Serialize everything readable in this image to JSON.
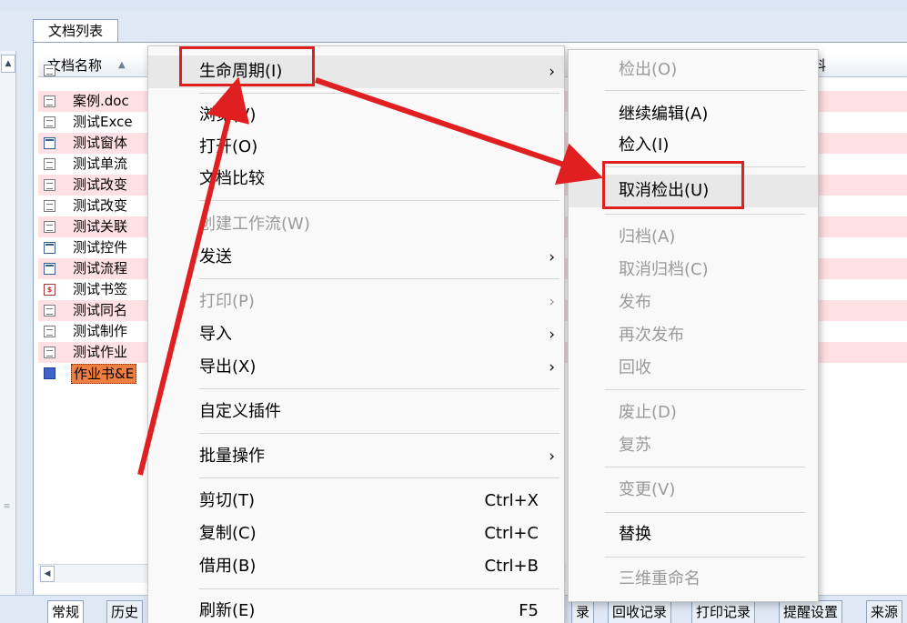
{
  "window": {
    "tab_label": "文档列表",
    "column_name": "文档名称",
    "sort_arrow": "▲",
    "column_right": "料"
  },
  "rows": [
    {
      "name": "案例.doc",
      "icon": "doc-icon"
    },
    {
      "name": "测试Exce",
      "icon": "doc-icon"
    },
    {
      "name": "测试窗体",
      "icon": "form-icon"
    },
    {
      "name": "测试单流",
      "icon": "doc-icon"
    },
    {
      "name": "测试改变",
      "icon": "doc-icon"
    },
    {
      "name": "测试改变",
      "icon": "doc-icon"
    },
    {
      "name": "测试关联",
      "icon": "doc-icon"
    },
    {
      "name": "测试控件",
      "icon": "form-icon"
    },
    {
      "name": "测试流程",
      "icon": "form-icon"
    },
    {
      "name": "测试书签",
      "icon": "bookmark-icon",
      "icon_text": "$"
    },
    {
      "name": "测试同名",
      "icon": "doc-icon"
    },
    {
      "name": "测试制作",
      "icon": "doc-icon"
    },
    {
      "name": "测试作业",
      "icon": "doc-icon"
    },
    {
      "name": "作业书&E",
      "icon": "blue-doc-icon"
    }
  ],
  "bottom_tabs": {
    "left": [
      "常规",
      "历史"
    ],
    "right": [
      "录",
      "回收记录",
      "打印记录",
      "提醒设置",
      "来源"
    ]
  },
  "context_menu": {
    "lifecycle": "生命周期(I)",
    "browse": "浏览(V)",
    "open": "打开(O)",
    "compare": "文档比较",
    "create_workflow": "创建工作流(W)",
    "send": "发送",
    "print": "打印(P)",
    "import": "导入",
    "export": "导出(X)",
    "custom_plugin": "自定义插件",
    "batch": "批量操作",
    "cut": "剪切(T)",
    "cut_shortcut": "Ctrl+X",
    "copy": "复制(C)",
    "copy_shortcut": "Ctrl+C",
    "borrow": "借用(B)",
    "borrow_shortcut": "Ctrl+B",
    "refresh": "刷新(E)",
    "refresh_shortcut": "F5",
    "arrow": "›"
  },
  "submenu": {
    "checkout": "检出(O)",
    "continue_edit": "继续编辑(A)",
    "checkin": "检入(I)",
    "cancel_checkout": "取消检出(U)",
    "archive": "归档(A)",
    "cancel_archive": "取消归档(C)",
    "publish": "发布",
    "republish": "再次发布",
    "recycle": "回收",
    "discard": "废止(D)",
    "revive": "复苏",
    "change": "变更(V)",
    "replace": "替换",
    "rename_3d": "三维重命名"
  },
  "colors": {
    "annotation_red": "#e02020",
    "selected_row": "#ef7f3f",
    "pink_row": "#ffe0e4"
  }
}
